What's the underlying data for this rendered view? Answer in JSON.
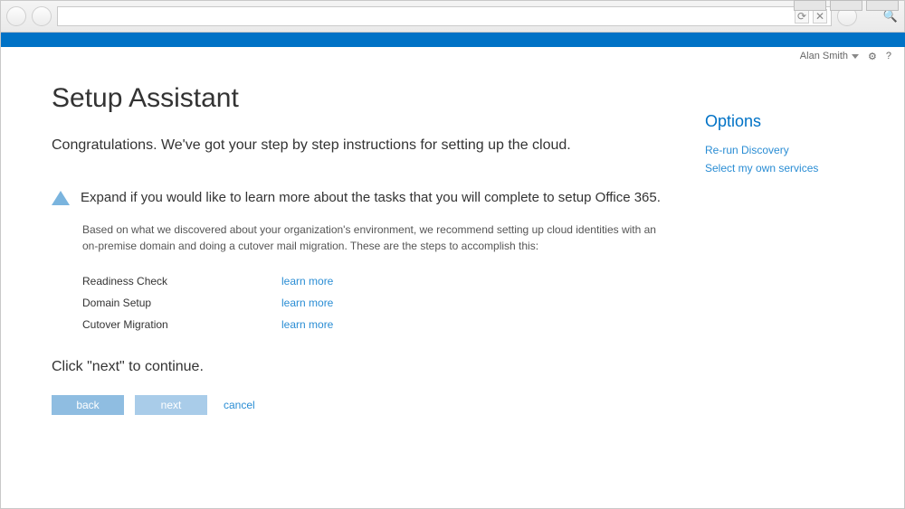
{
  "util": {
    "user": "Alan Smith",
    "gear": "⚙",
    "help": "?"
  },
  "title": "Setup Assistant",
  "subtitle": "Congratulations. We've got your step by step instructions for setting up the cloud.",
  "expand_text": "Expand if you would like to learn more about the tasks that you will complete to setup Office 365.",
  "description": "Based on what we discovered about your organization's environment, we recommend setting up cloud identities with an on-premise domain and doing a cutover mail migration. These are the steps to accomplish this:",
  "tasks": [
    {
      "name": "Readiness Check",
      "link": "learn more"
    },
    {
      "name": "Domain Setup",
      "link": "learn more"
    },
    {
      "name": "Cutover Migration",
      "link": "learn more"
    }
  ],
  "continue_text": "Click \"next\" to continue.",
  "buttons": {
    "back": "back",
    "next": "next",
    "cancel": "cancel"
  },
  "options": {
    "title": "Options",
    "links": [
      "Re-run Discovery",
      "Select my own services"
    ]
  },
  "chrome": {
    "refresh": "⟳",
    "close": "✕",
    "search": "🔍"
  }
}
